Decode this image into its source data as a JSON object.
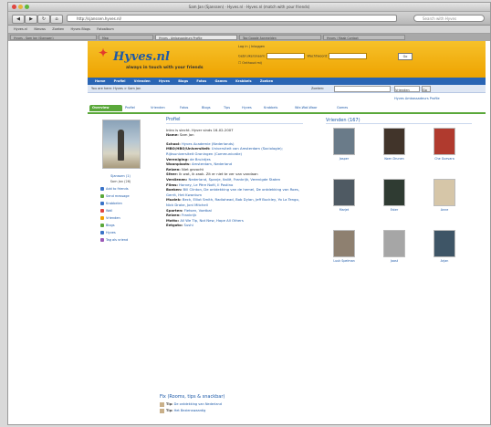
{
  "window": {
    "title": "Sam Jan (Sjanssen) · Hyves.nl · Hyves.nl (match with your friends)"
  },
  "toolbar": {
    "back": "◀",
    "forward": "▶",
    "reload": "↻",
    "home": "⌂",
    "url": "http://sjanssen.hyves.nl/",
    "search_placeholder": "Search with Hyves"
  },
  "bookmarks": [
    "Hyves.nl",
    "Nieuws",
    "Zoeken",
    "Hyves Blogs",
    "Fotoalbum"
  ],
  "tabs": [
    {
      "label": "Hyves - Sam Jan (Sjanssen)"
    },
    {
      "label": "Map"
    },
    {
      "label": "Hyves - Ambassadeurs Profile"
    },
    {
      "label": "Tag Google Aanmelden"
    },
    {
      "label": "Hyves | Maak Contact"
    }
  ],
  "site": {
    "logo": "Hyves.nl",
    "tagline": "always in touch with your friends",
    "login_label": "Log in | Inloggen",
    "user_label": "Gebruikersnaam:",
    "pass_label": "Wachtwoord:",
    "remember_label": "Onthoud mij",
    "go_label": "Go",
    "nav": [
      "Home",
      "Profiel",
      "Vrienden",
      "Hyves",
      "Blogs",
      "Fotos",
      "Games",
      "Krabbels",
      "Zoeken"
    ],
    "breadcrumb": "You are here: Hyves > Sam Jan",
    "search_label": "Zoeken:",
    "search_select": "Vrienden",
    "search_go": "Go",
    "member_link": "Hyves Ambassadeurs Profile",
    "subtabs": [
      "Overview",
      "Profiel",
      "Vrienden",
      "Fotos",
      "Blogs",
      "Tips",
      "Hyves",
      "Krabbels",
      "Wie-Wat-Waar",
      "Games"
    ]
  },
  "left": {
    "name": "Sjanssen (1)",
    "since": "Sam Jan (26)",
    "links": [
      {
        "label": "Add to friends",
        "color": "#3a73c8"
      },
      {
        "label": "Send message",
        "color": "#5aa83a"
      },
      {
        "label": "Krabbelen",
        "color": "#3a73c8"
      },
      {
        "label": "Wall",
        "color": "#e0463f"
      },
      {
        "label": "Vrienden",
        "color": "#f0a000"
      },
      {
        "label": "Blogs",
        "color": "#5aa83a"
      },
      {
        "label": "Hyves",
        "color": "#3a73c8"
      },
      {
        "label": "Tag als vriend",
        "color": "#9b59b6"
      }
    ]
  },
  "profile": {
    "heading": "Profiel",
    "intro": "Intro is slecht. Hyver sinds 16-02-2007",
    "name_key": "Name:",
    "name_val": "Sam Jan",
    "rows": [
      {
        "k": "School:",
        "v": "Hyves Academie (Nederlands)"
      },
      {
        "k": "MBO/HBO/Universiteit:",
        "v": "Universiteit van Amsterdam (Sociologie); Rijksuniversiteit Groningen (Communicatie)"
      },
      {
        "k": "Vereniging:",
        "v": "de Bruintjes"
      },
      {
        "k": "Woonplaats:",
        "v": "Amsterdam, Nederland"
      },
      {
        "k": "Reizen:",
        "v": "Niet gezocht"
      },
      {
        "k": "Sfeer:",
        "v": "Ik wat, ik zaak. Zit er niet te ver van vandaan"
      },
      {
        "k": "Verdienen:",
        "v": "Nederland, Spanje, Italië, Frankrijk, Verenigde Staten"
      },
      {
        "k": "Films:",
        "v": "Harvey, Le Père Noël, Il Postino"
      },
      {
        "k": "Boeken:",
        "v": "Bill Clinton, De ontdekking van de hemel, De ontdekking van Roes, Gerrit, Het Kwantum"
      },
      {
        "k": "Muziek:",
        "v": "Beck, Elliot Smith, Radiohead, Bob Dylan, Jeff Buckley, Yo La Tengo, Nick Drake, Joni Mitchell"
      },
      {
        "k": "Sporten:",
        "v": "Fietsen, Voetbal"
      },
      {
        "k": "Reizen:",
        "v": "Frankrijk"
      },
      {
        "k": "Motto:",
        "v": "All We Tip, Not New, Hope All Others"
      },
      {
        "k": "Eetgoto:",
        "v": "Sushi"
      }
    ],
    "groups_heading": "Fix (Rooms, tips & snackbar)",
    "groups": [
      {
        "k": "Tip:",
        "v": "De ontdekking van Nederland"
      },
      {
        "k": "Tip:",
        "v": "Het Bezienswaardig"
      }
    ]
  },
  "friends": {
    "heading": "Vrienden (167)",
    "items": [
      {
        "name": "Jasper",
        "color": "#6a7b89"
      },
      {
        "name": "Koen Drunen",
        "color": "#41342a"
      },
      {
        "name": "Che Guevara",
        "color": "#b03a2e"
      },
      {
        "name": "Marjet",
        "color": "#4f5a63"
      },
      {
        "name": "Ester",
        "color": "#2f3b32"
      },
      {
        "name": "Anne",
        "color": "#d6c6a8"
      },
      {
        "name": "Luuk Spelman",
        "color": "#8e8070"
      },
      {
        "name": "Joost",
        "color": "#a6a6a6"
      },
      {
        "name": "Arjan",
        "color": "#3e5566"
      }
    ]
  }
}
